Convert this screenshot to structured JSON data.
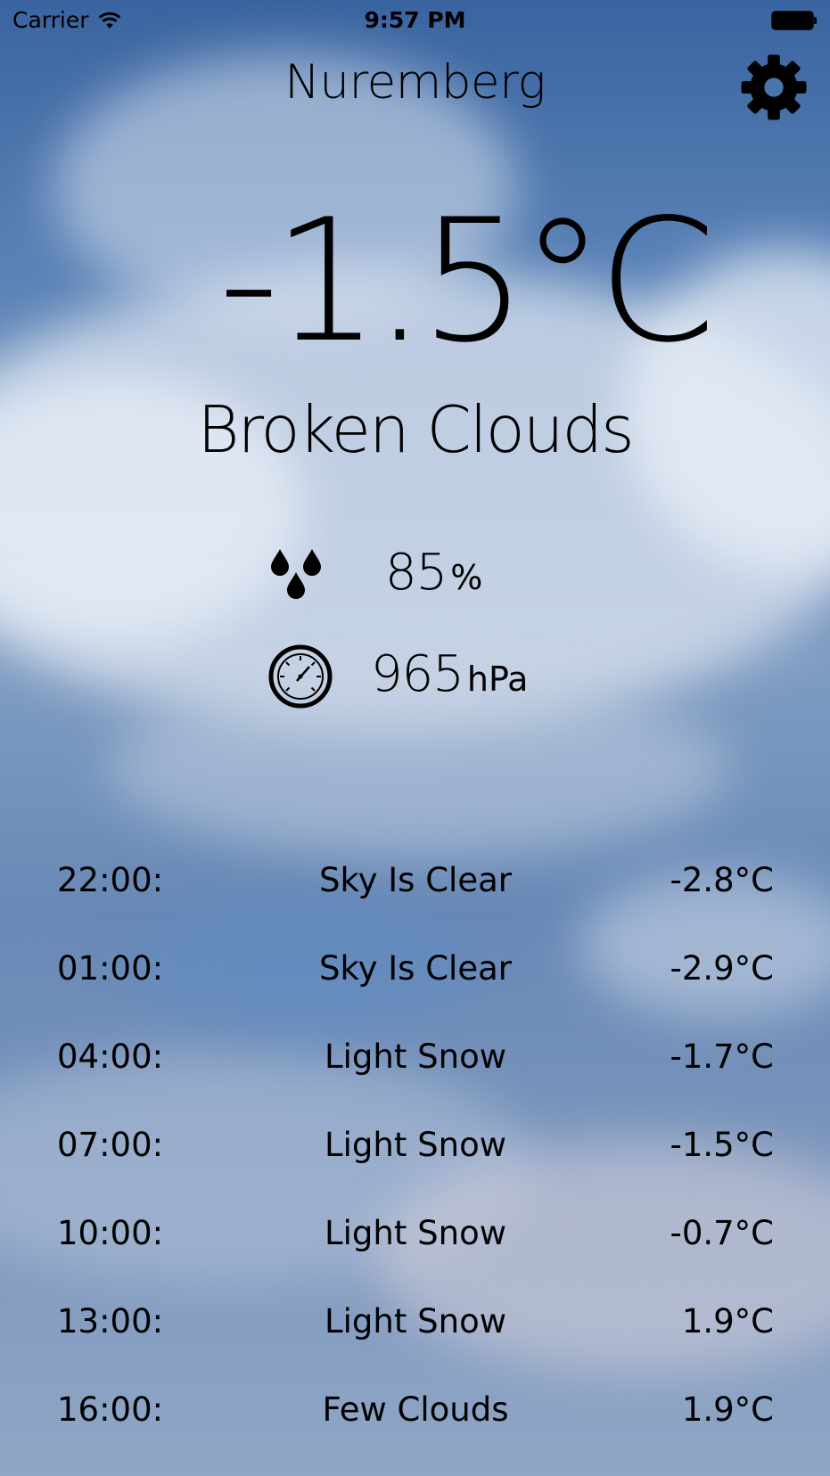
{
  "status_bar": {
    "carrier": "Carrier",
    "time": "9:57 PM"
  },
  "header": {
    "city": "Nuremberg",
    "settings_icon": "gear-icon"
  },
  "current": {
    "temperature": "-1.5°C",
    "condition": "Broken Clouds",
    "humidity_value": "85",
    "humidity_unit": "%",
    "humidity_icon": "water-drops-icon",
    "pressure_value": "965",
    "pressure_unit": "hPa",
    "pressure_icon": "barometer-icon"
  },
  "forecast": [
    {
      "time": "22:00:",
      "description": "Sky Is Clear",
      "temperature": "-2.8°C"
    },
    {
      "time": "01:00:",
      "description": "Sky Is Clear",
      "temperature": "-2.9°C"
    },
    {
      "time": "04:00:",
      "description": "Light Snow",
      "temperature": "-1.7°C"
    },
    {
      "time": "07:00:",
      "description": "Light Snow",
      "temperature": "-1.5°C"
    },
    {
      "time": "10:00:",
      "description": "Light Snow",
      "temperature": "-0.7°C"
    },
    {
      "time": "13:00:",
      "description": "Light Snow",
      "temperature": "1.9°C"
    },
    {
      "time": "16:00:",
      "description": "Few Clouds",
      "temperature": "1.9°C"
    }
  ],
  "colors": {
    "text": "#000000",
    "sky_top": "#3a64a0",
    "cloud": "#e4eaf3"
  }
}
